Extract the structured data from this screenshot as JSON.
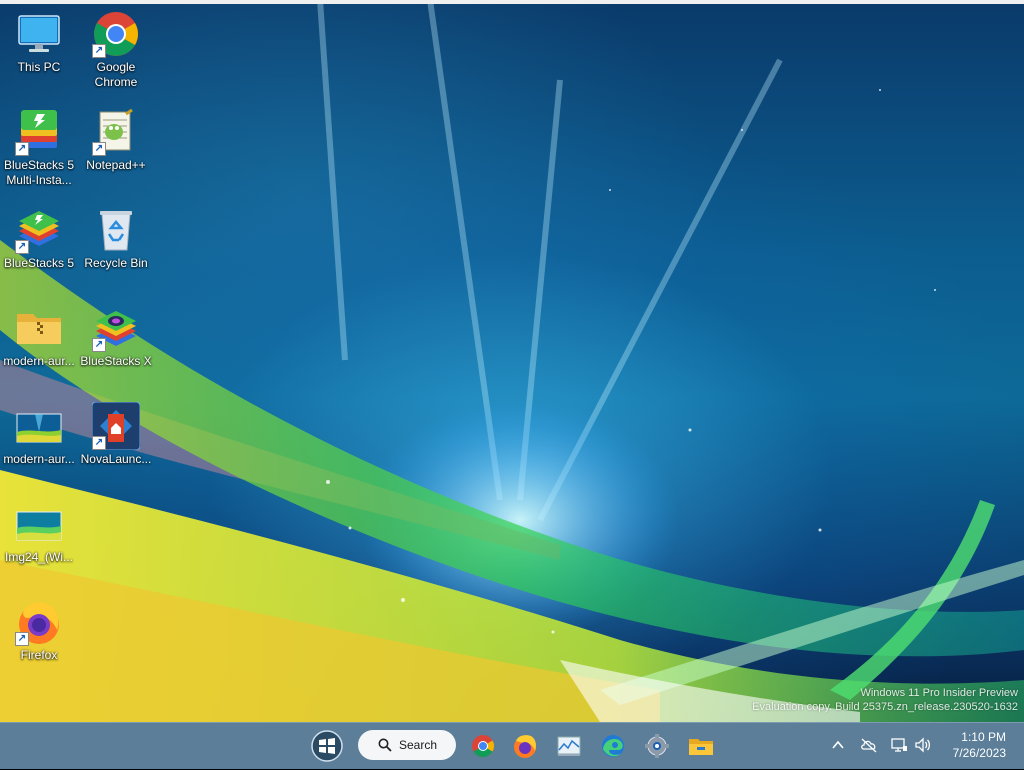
{
  "desktop": {
    "icons": [
      {
        "label": "This PC",
        "icon": "this-pc-icon",
        "shortcut": false
      },
      {
        "label": "Google Chrome",
        "icon": "chrome-icon",
        "shortcut": true
      },
      {
        "label": "BlueStacks 5 Multi-Insta...",
        "icon": "bluestacks-multi-instance-icon",
        "shortcut": true
      },
      {
        "label": "Notepad++",
        "icon": "notepad-plus-plus-icon",
        "shortcut": true
      },
      {
        "label": "BlueStacks 5",
        "icon": "bluestacks-icon",
        "shortcut": true
      },
      {
        "label": "Recycle Bin",
        "icon": "recycle-bin-icon",
        "shortcut": false
      },
      {
        "label": "modern-aur...",
        "icon": "zip-folder-icon",
        "shortcut": false
      },
      {
        "label": "BlueStacks X",
        "icon": "bluestacks-x-icon",
        "shortcut": true
      },
      {
        "label": "modern-aur...",
        "icon": "image-file-icon",
        "shortcut": false
      },
      {
        "label": "NovaLaunc...",
        "icon": "nova-launcher-icon",
        "shortcut": true
      },
      {
        "label": "Img24_(Wi...",
        "icon": "image-file-icon",
        "shortcut": false
      },
      {
        "label": "Firefox",
        "icon": "firefox-icon",
        "shortcut": true
      }
    ],
    "shortcut_arrow": "↗"
  },
  "watermark": {
    "line1": "Windows 11 Pro Insider Preview",
    "line2": "Evaluation copy. Build 25375.zn_release.230520-1632"
  },
  "taskbar": {
    "start_icon": "windows-start-icon",
    "search": {
      "label": "Search",
      "icon": "search-icon"
    },
    "pinned": [
      {
        "name": "Google Chrome",
        "icon": "chrome-icon"
      },
      {
        "name": "Firefox",
        "icon": "firefox-icon"
      },
      {
        "name": "Performance Monitor",
        "icon": "performance-monitor-icon"
      },
      {
        "name": "Microsoft Edge",
        "icon": "edge-icon"
      },
      {
        "name": "Settings",
        "icon": "settings-icon"
      },
      {
        "name": "File Explorer",
        "icon": "file-explorer-icon"
      }
    ],
    "tray": {
      "overflow_icon": "chevron-up-icon",
      "network_icon": "cloud-offline-icon",
      "display_icon": "monitor-icon",
      "volume_icon": "speaker-icon"
    },
    "clock": {
      "time": "1:10 PM",
      "date": "7/26/2023"
    }
  },
  "colors": {
    "taskbar_bg": "#5c7e98",
    "search_bg": "#f4f6f8"
  }
}
